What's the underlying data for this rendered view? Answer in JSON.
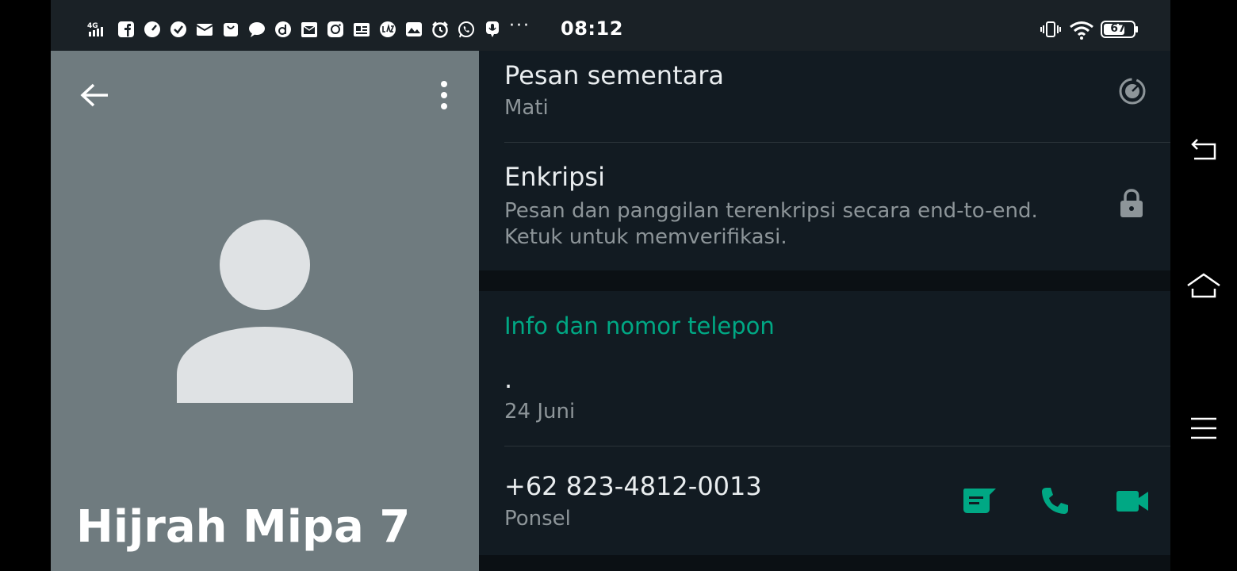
{
  "status_bar": {
    "network_label": "4G",
    "time": "08:12",
    "battery": "67",
    "more_indicator": "···",
    "notification_icons": [
      "signal-4g-icon",
      "facebook-icon",
      "speedometer-icon",
      "check-circle-icon",
      "mail-icon",
      "shopping-bag-icon",
      "chat-bubble-icon",
      "dana-icon",
      "calendar-mail-icon",
      "instagram-icon",
      "news-icon",
      "lazada-icon",
      "photo-icon",
      "alarm-icon",
      "whatsapp-icon",
      "microphone-icon"
    ]
  },
  "contact": {
    "name": "Hijrah Mipa 7"
  },
  "settings": {
    "disappearing": {
      "title": "Pesan sementara",
      "subtitle": "Mati"
    },
    "encryption": {
      "title": "Enkripsi",
      "subtitle": "Pesan dan panggilan terenkripsi secara end-to-end. Ketuk untuk memverifikasi."
    }
  },
  "info_section": {
    "header": "Info dan nomor telepon",
    "about": ".",
    "about_date": "24 Juni",
    "phone": "+62 823-4812-0013",
    "phone_type": "Ponsel"
  },
  "colors": {
    "accent": "#00a884",
    "panel_bg": "#121b22",
    "header_bg": "#6f7b7f",
    "avatar": "#dfe2e4"
  }
}
